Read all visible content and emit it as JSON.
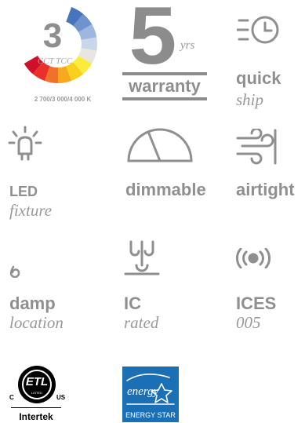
{
  "cct": {
    "number": "3",
    "label": "CCT TCC",
    "range": "2 700/3 000/4 000 K",
    "colors": [
      "#d0102a",
      "#e9302a",
      "#f2712a",
      "#f7a81e",
      "#f9d01a",
      "#fbeb3c",
      "#e8e6e2",
      "#c9d6ea",
      "#9db8de",
      "#6f93cc",
      "#4775bd"
    ]
  },
  "warranty": {
    "number": "5",
    "years": "yrs",
    "label": "warranty"
  },
  "quick_ship": {
    "line1": "quick",
    "line2": "ship",
    "icon": "clock-speed-icon"
  },
  "led": {
    "line1": "LED",
    "line2": "fixture",
    "icon": "led-bulb-icon"
  },
  "dimmable": {
    "label": "dimmable",
    "icon": "dimmer-dial-icon"
  },
  "airtight": {
    "label": "airtight",
    "icon": "airflow-icon"
  },
  "damp": {
    "line1": "damp",
    "line2": "location",
    "icon": "water-drop-icon"
  },
  "ic": {
    "line1": "IC",
    "line2": "rated",
    "icon": "ic-insulation-icon"
  },
  "ices": {
    "line1": "ICES",
    "line2": "005",
    "icon": "radio-waves-icon"
  },
  "etl": {
    "letters": "ETL",
    "left": "C",
    "right": "US",
    "small": "LISTED",
    "brand": "Intertek"
  },
  "energy_star": {
    "script": "energy",
    "label": "ENERGY STAR",
    "color": "#1b6fb5"
  }
}
